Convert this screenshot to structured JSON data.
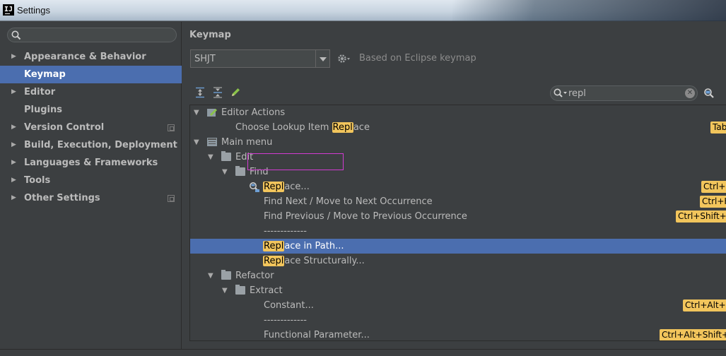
{
  "window": {
    "title": "Settings"
  },
  "sidebar": {
    "search_placeholder": "",
    "items": [
      {
        "label": "Appearance & Behavior",
        "expandable": true,
        "selected": false,
        "project": false
      },
      {
        "label": "Keymap",
        "expandable": false,
        "selected": true,
        "project": false
      },
      {
        "label": "Editor",
        "expandable": true,
        "selected": false,
        "project": false
      },
      {
        "label": "Plugins",
        "expandable": false,
        "selected": false,
        "project": false
      },
      {
        "label": "Version Control",
        "expandable": true,
        "selected": false,
        "project": true
      },
      {
        "label": "Build, Execution, Deployment",
        "expandable": true,
        "selected": false,
        "project": false
      },
      {
        "label": "Languages & Frameworks",
        "expandable": true,
        "selected": false,
        "project": false
      },
      {
        "label": "Tools",
        "expandable": true,
        "selected": false,
        "project": false
      },
      {
        "label": "Other Settings",
        "expandable": true,
        "selected": false,
        "project": true
      }
    ]
  },
  "main": {
    "title": "Keymap",
    "keymap_value": "SHJT",
    "based_on": "Based on Eclipse keymap",
    "filter": {
      "value": "repl"
    },
    "tree": {
      "editor_actions": "Editor Actions",
      "choose_lookup": {
        "pre": "Choose Lookup Item ",
        "hl": "Repl",
        "post": "ace",
        "shortcut": "Tab"
      },
      "main_menu": "Main menu",
      "edit": "Edit",
      "find": "Find",
      "replace": {
        "pre": "",
        "hl": "Repl",
        "post": "ace...",
        "shortcut": "Ctrl+F"
      },
      "find_next": {
        "text": "Find Next / Move to Next Occurrence",
        "shortcut": "Ctrl+K"
      },
      "find_prev": {
        "text": "Find Previous / Move to Previous Occurrence",
        "shortcut": "Ctrl+Shift+K"
      },
      "separator": "-------------",
      "replace_in_path": {
        "pre": "",
        "hl": "Repl",
        "post": "ace in Path..."
      },
      "replace_structurally": {
        "pre": "",
        "hl": "Repl",
        "post": "ace Structurally..."
      },
      "refactor": "Refactor",
      "extract": "Extract",
      "constant": {
        "text": "Constant...",
        "shortcut": "Ctrl+Alt+C"
      },
      "separator2": "-------------",
      "functional_parameter": {
        "text": "Functional Parameter...",
        "shortcut": "Ctrl+Alt+Shift+P"
      }
    }
  },
  "colors": {
    "selection": "#4b6eaf",
    "highlight": "#f2c55c",
    "background": "#3c3f41"
  }
}
